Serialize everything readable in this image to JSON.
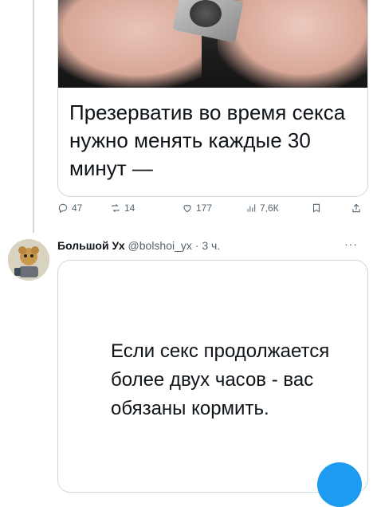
{
  "tweet1": {
    "headline": "Презерватив во время секса нужно менять каждые 30 минут —",
    "stats": {
      "replies": "47",
      "retweets": "14",
      "likes": "177",
      "views": "7,6К"
    }
  },
  "tweet2": {
    "author_name": "Большой Ух",
    "handle": "@bolshoi_yx",
    "separator": "·",
    "time": "3 ч.",
    "more": "···",
    "card_text": "Если секс продолжается более двух часов - вас обязаны кормить."
  },
  "colors": {
    "text_primary": "#0f1419",
    "text_secondary": "#536471",
    "border": "#cfd9de",
    "accent": "#1d9bf0"
  }
}
